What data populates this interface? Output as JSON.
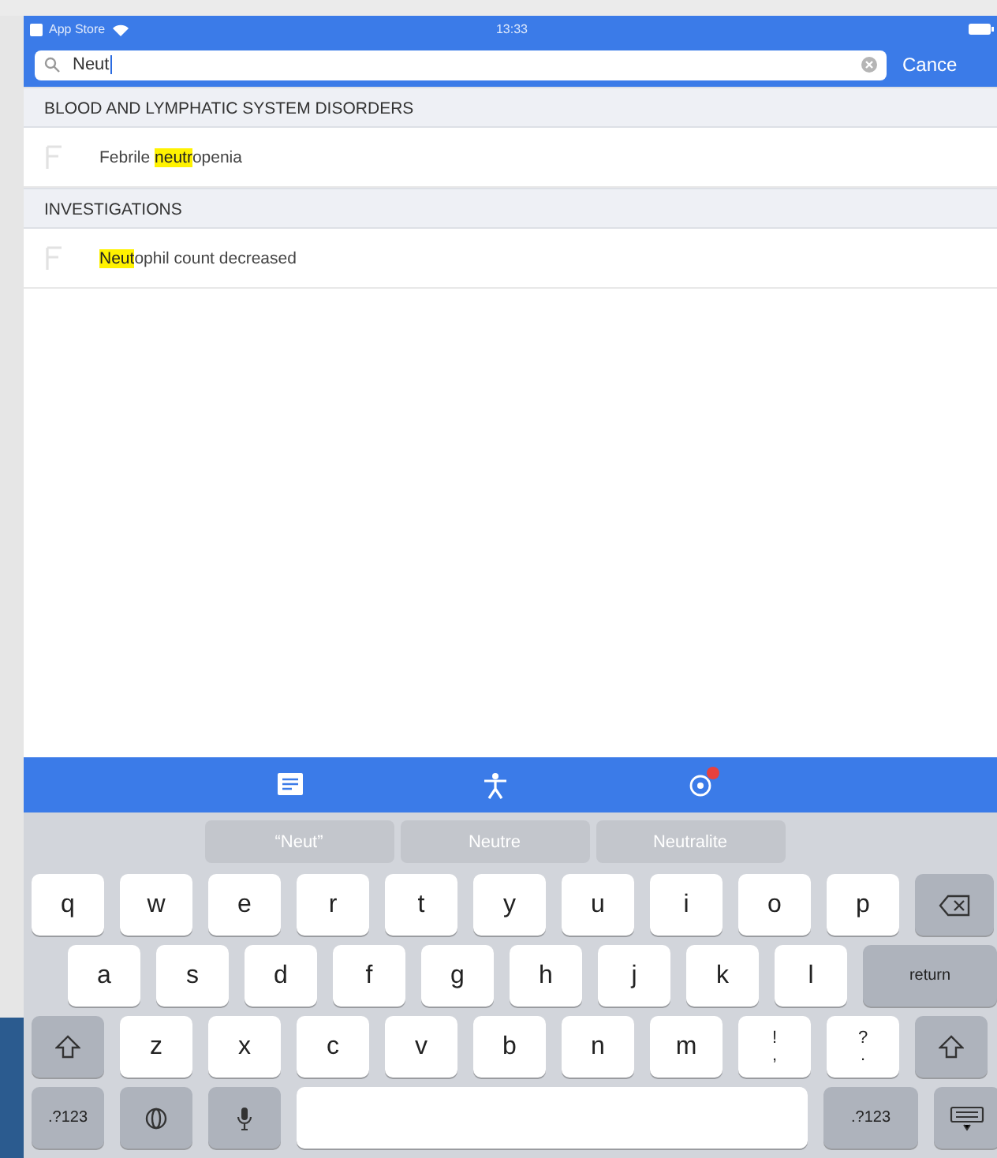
{
  "status_bar": {
    "carrier": "App Store",
    "time": "13:33"
  },
  "search": {
    "value": "Neut",
    "cancel": "Cance"
  },
  "sections": [
    {
      "title": "BLOOD AND LYMPHATIC SYSTEM DISORDERS",
      "rows": [
        {
          "parts": [
            {
              "text": "Febrile ",
              "highlight": false
            },
            {
              "text": "neutr",
              "highlight": true
            },
            {
              "text": "openia",
              "highlight": false
            }
          ]
        }
      ]
    },
    {
      "title": "INVESTIGATIONS",
      "rows": [
        {
          "parts": [
            {
              "text": "Neut",
              "highlight": true
            },
            {
              "text": "ophil count decreased",
              "highlight": false
            }
          ]
        }
      ]
    }
  ],
  "tab_bar": [
    {
      "kind": "list",
      "badge": false
    },
    {
      "kind": "body",
      "badge": false
    },
    {
      "kind": "virus",
      "badge": true
    }
  ],
  "suggestions": [
    "“Neut”",
    "Neutre",
    "Neutralite"
  ],
  "keyboard": [
    [
      {
        "kind": "letter",
        "label": "q"
      },
      {
        "kind": "letter",
        "label": "w"
      },
      {
        "kind": "letter",
        "label": "e"
      },
      {
        "kind": "letter",
        "label": "r"
      },
      {
        "kind": "letter",
        "label": "t"
      },
      {
        "kind": "letter",
        "label": "y"
      },
      {
        "kind": "letter",
        "label": "u"
      },
      {
        "kind": "letter",
        "label": "i"
      },
      {
        "kind": "letter",
        "label": "o"
      },
      {
        "kind": "letter",
        "label": "p"
      },
      {
        "kind": "backspace"
      }
    ],
    [
      {
        "kind": "letter",
        "label": "a"
      },
      {
        "kind": "letter",
        "label": "s"
      },
      {
        "kind": "letter",
        "label": "d"
      },
      {
        "kind": "letter",
        "label": "f"
      },
      {
        "kind": "letter",
        "label": "g"
      },
      {
        "kind": "letter",
        "label": "h"
      },
      {
        "kind": "letter",
        "label": "j"
      },
      {
        "kind": "letter",
        "label": "k"
      },
      {
        "kind": "letter",
        "label": "l"
      },
      {
        "kind": "return",
        "label": "return"
      }
    ],
    [
      {
        "kind": "shift"
      },
      {
        "kind": "letter",
        "label": "z"
      },
      {
        "kind": "letter",
        "label": "x"
      },
      {
        "kind": "letter",
        "label": "c"
      },
      {
        "kind": "letter",
        "label": "v"
      },
      {
        "kind": "letter",
        "label": "b"
      },
      {
        "kind": "letter",
        "label": "n"
      },
      {
        "kind": "letter",
        "label": "m"
      },
      {
        "kind": "punct",
        "label": "!",
        "alt": ","
      },
      {
        "kind": "punct",
        "label": "?",
        "alt": "."
      },
      {
        "kind": "shift"
      }
    ],
    [
      {
        "kind": "numbers",
        "label": ".?123"
      },
      {
        "kind": "globe"
      },
      {
        "kind": "mic"
      },
      {
        "kind": "space"
      },
      {
        "kind": "numbers",
        "label": ".?123"
      },
      {
        "kind": "hide"
      }
    ]
  ]
}
